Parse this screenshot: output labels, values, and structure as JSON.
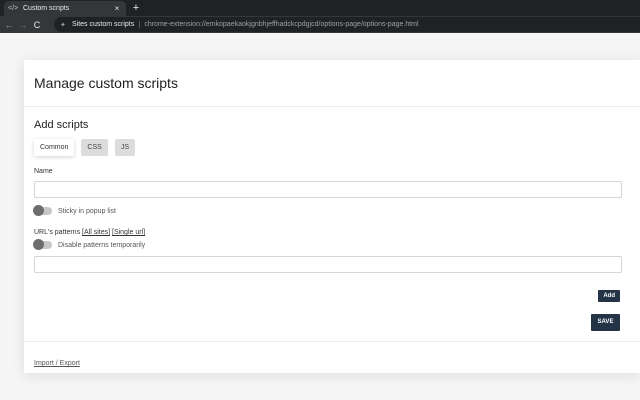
{
  "browser": {
    "tab_title": "Custom scripts",
    "tab_close": "×",
    "new_tab": "+",
    "back": "←",
    "forward": "→",
    "reload": "C",
    "site_name": "Sites custom scripts",
    "separator": "|",
    "url": "chrome-extension://emkopaekaokjgnbhjeffhadckcpdgjcd/options-page/options-page.html"
  },
  "page": {
    "title": "Manage custom scripts",
    "section_title": "Add scripts",
    "tabs": [
      {
        "label": "Common",
        "active": true
      },
      {
        "label": "CSS",
        "active": false
      },
      {
        "label": "JS",
        "active": false
      }
    ],
    "name_label": "Name",
    "name_value": "",
    "sticky_label": "Sticky in popup list",
    "patterns_label": "URL's patterns",
    "all_sites_link": "[All sites]",
    "single_url_link": "[Single url]",
    "disable_label": "Disable patterns temporarily",
    "pattern_value": "",
    "add_label": "Add",
    "save_label": "SAVE",
    "import_export": "Import / Export"
  },
  "colors": {
    "primary_button": "#243447",
    "chrome_dark": "#202124",
    "chrome_mid": "#35363a"
  }
}
